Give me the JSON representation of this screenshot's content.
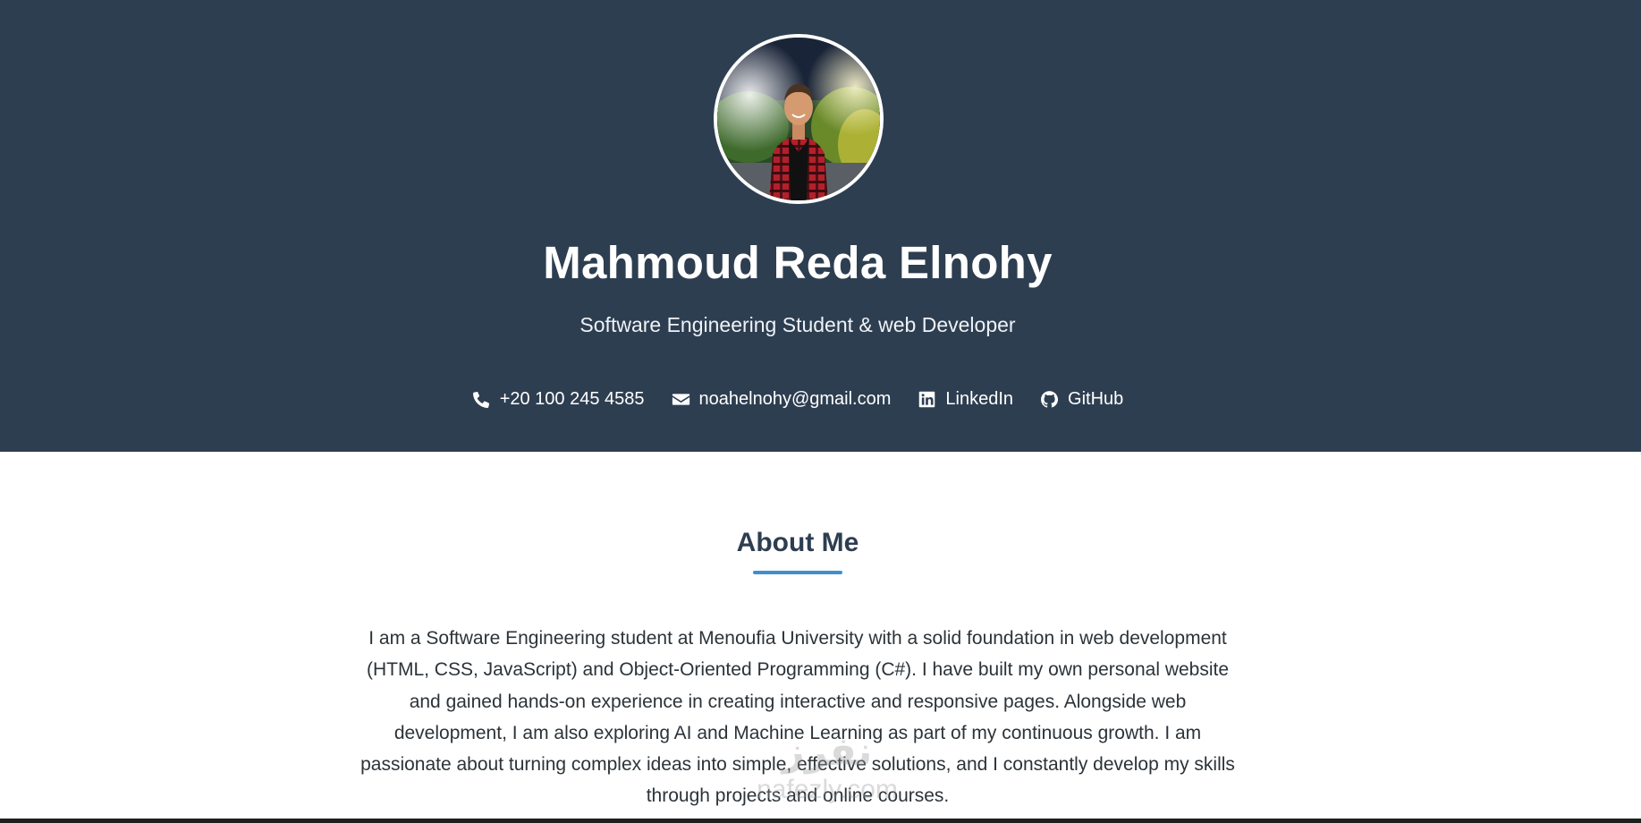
{
  "header": {
    "name": "Mahmoud Reda Elnohy",
    "tagline": "Software Engineering Student & web Developer",
    "contacts": [
      {
        "icon": "phone-icon",
        "label": "+20 100 245 4585"
      },
      {
        "icon": "envelope-icon",
        "label": "noahelnohy@gmail.com"
      },
      {
        "icon": "linkedin-icon",
        "label": "LinkedIn"
      },
      {
        "icon": "github-icon",
        "label": "GitHub"
      }
    ]
  },
  "about": {
    "title": "About Me",
    "text": "I am a Software Engineering student at Menoufia University with a solid foundation in web development (HTML, CSS, JavaScript) and Object-Oriented Programming (C#). I have built my own personal website and gained hands-on experience in creating interactive and responsive pages. Alongside web development, I am also exploring AI and Machine Learning as part of my continuous growth. I am passionate about turning complex ideas into simple, effective solutions, and I constantly develop my skills through projects and online courses."
  },
  "watermark": {
    "logo": "نفرز",
    "text": "nafezly.com"
  },
  "colors": {
    "header_bg": "#2e3e51",
    "accent": "#3f8fce",
    "heading": "#2e3e51",
    "body_text": "#2c3338"
  }
}
